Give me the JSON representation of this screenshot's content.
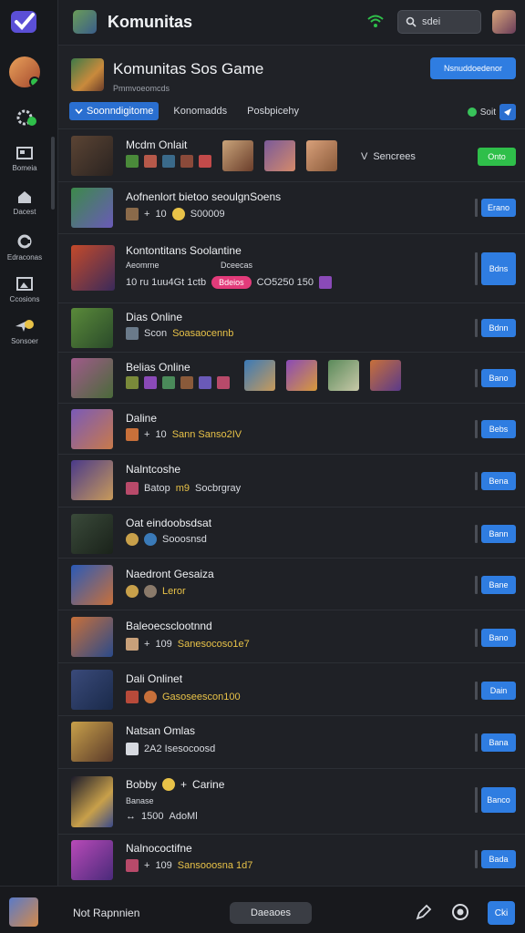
{
  "app": {
    "title": "Komunitas"
  },
  "search": {
    "label": "sdei"
  },
  "rail": {
    "items": [
      {
        "label": "Bomeia",
        "icon": "inbox-icon"
      },
      {
        "label": "Dacest",
        "icon": "home-icon"
      },
      {
        "label": "Edraconas",
        "icon": "refresh-icon"
      },
      {
        "label": "Ccosions",
        "icon": "photo-icon"
      },
      {
        "label": "Sonsoer",
        "icon": "paper-plane-icon"
      }
    ]
  },
  "header": {
    "title": "Komunitas Sos Game",
    "subtitle": "Pmmvoeomcds",
    "action_label": "Nsnuddoedenor",
    "tabs": [
      {
        "label": "Soonndigitome",
        "active": true
      },
      {
        "label": "Konomadds",
        "active": false
      },
      {
        "label": "Posbpicehy",
        "active": false
      }
    ],
    "right_label": "Soit"
  },
  "rows": [
    {
      "title": "Mcdm Onlait",
      "meta": "",
      "right_text": "Sencrees",
      "button": "Onto",
      "button_style": "green"
    },
    {
      "title": "Aofnenlort bietoo seoulgnSoens",
      "meta": "10",
      "meta_y": "S00009",
      "button": "Erano"
    },
    {
      "title": "Kontontitans Soolantine",
      "sub_a": "Aeomrne",
      "sub_b": "Dceecas",
      "meta": "10 ru 1uu4Gt 1ctb",
      "pill": "Bdeios",
      "meta2": "CO5250 150",
      "button": "Bdns"
    },
    {
      "title": "Dias Online",
      "meta": "Scon",
      "meta_y": "Soasaocennb",
      "button": "Bdnn"
    },
    {
      "title": "Belias Online",
      "meta": "",
      "button": "Bano"
    },
    {
      "title": "Daline",
      "meta": "10",
      "meta_y": "Sann Sanso2IV",
      "button": "Bebs"
    },
    {
      "title": "Nalntcoshe",
      "meta": "Batop",
      "meta_y": "m9",
      "meta2": "Socbrgray",
      "button": "Bena"
    },
    {
      "title": "Oat eindoobsdsat",
      "meta": "Sooosnsd",
      "button": "Bann"
    },
    {
      "title": "Naedront Gesaiza",
      "meta_y": "Leror",
      "button": "Bane"
    },
    {
      "title": "Baleoecsclootnnd",
      "meta": "109",
      "meta_y": "Sanesocoso1e7",
      "button": "Bano"
    },
    {
      "title": "Dali Onlinet",
      "meta_y": "Gasoseescon100",
      "button": "Dain"
    },
    {
      "title": "Natsan Omlas",
      "meta": "2A2 Isesocoosd",
      "button": "Bana"
    },
    {
      "title": "Bobby",
      "title2": "Carine",
      "sub_a": "Banase",
      "meta": "1500",
      "meta2": "AdoMl",
      "button": "Banco"
    },
    {
      "title": "Nalnococtifne",
      "meta": "109",
      "meta_y": "Sansooosna 1d7",
      "button": "Bada"
    }
  ],
  "bottom": {
    "label": "Not Rapnnien",
    "button": "Daeaoes",
    "chat_label": "Cki"
  },
  "colors": {
    "accent": "#2f7de1",
    "online": "#2fbf4a",
    "pill": "#e23b7a",
    "highlight": "#e8c248"
  }
}
